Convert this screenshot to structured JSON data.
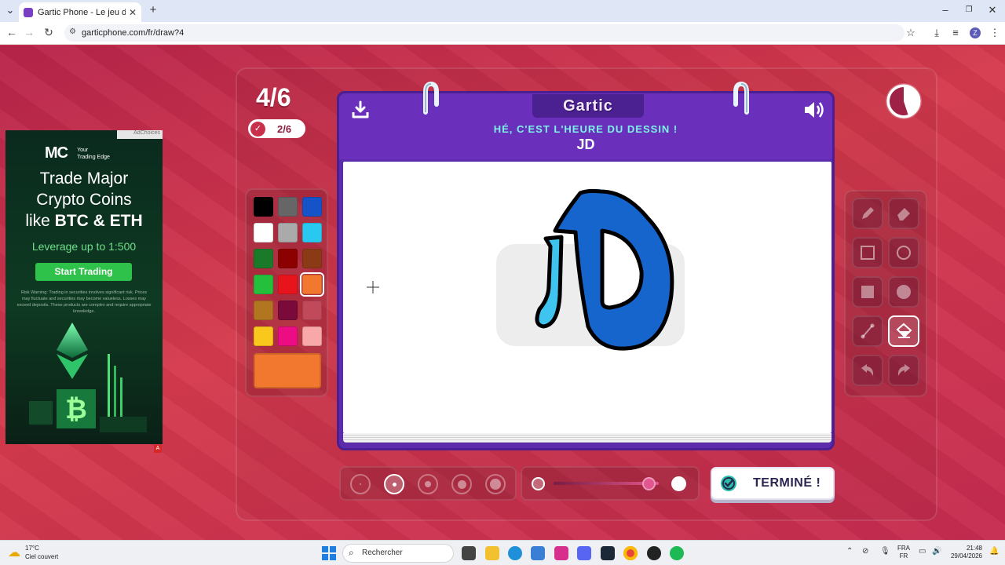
{
  "browser": {
    "tab_title": "Gartic Phone - Le jeu du télépho",
    "url": "garticphone.com/fr/draw?4",
    "avatar_letter": "Z"
  },
  "ad": {
    "tag": "AdChoices",
    "logo_mark": "MC",
    "logo_tagline_1": "Your",
    "logo_tagline_2": "Trading Edge",
    "headline_1": "Trade Major",
    "headline_2": "Crypto Coins",
    "headline_3_prefix": "like ",
    "headline_3_bold": "BTC & ETH",
    "leverage": "Leverage up to 1:500",
    "cta": "Start Trading",
    "warning": "Risk Warning: Trading in securities involves significant risk. Prices may fluctuate and securities may become valueless. Losses may exceed deposits. These products are complex and require appropriate knowledge.",
    "badge": "A"
  },
  "game": {
    "round": "4/6",
    "players_done": "2/6",
    "brand": "Gartic",
    "prompt": "HÉ, C'EST L'HEURE DU DESSIN !",
    "word": "JD",
    "timer_remaining_fraction": 0.45,
    "done_button": "TERMINÉ !",
    "palette": [
      "#000000",
      "#666666",
      "#1454c8",
      "#ffffff",
      "#aaaaaa",
      "#28c8f0",
      "#1a7a2a",
      "#8c0000",
      "#8a3a14",
      "#24c03c",
      "#e8141c",
      "#f27830",
      "#b27620",
      "#7a0a3a",
      "#c04a5a",
      "#f8c81c",
      "#ec0c84",
      "#f8a8a8"
    ],
    "selected_color": "#f27830",
    "brush_sizes": 5,
    "selected_brush_size_index": 1,
    "opacity_fraction": 0.9,
    "tools": [
      "pencil-icon",
      "eraser-icon",
      "rectangle-outline-icon",
      "circle-outline-icon",
      "rectangle-fill-icon",
      "circle-fill-icon",
      "line-icon",
      "bucket-icon",
      "undo-icon",
      "redo-icon"
    ],
    "selected_tool": "bucket-icon"
  },
  "taskbar": {
    "temperature": "17°C",
    "weather": "Ciel couvert",
    "search_placeholder": "Rechercher",
    "lang_1": "FRA",
    "lang_2": "FR",
    "time": "21:48",
    "date": "29/04/2026"
  }
}
